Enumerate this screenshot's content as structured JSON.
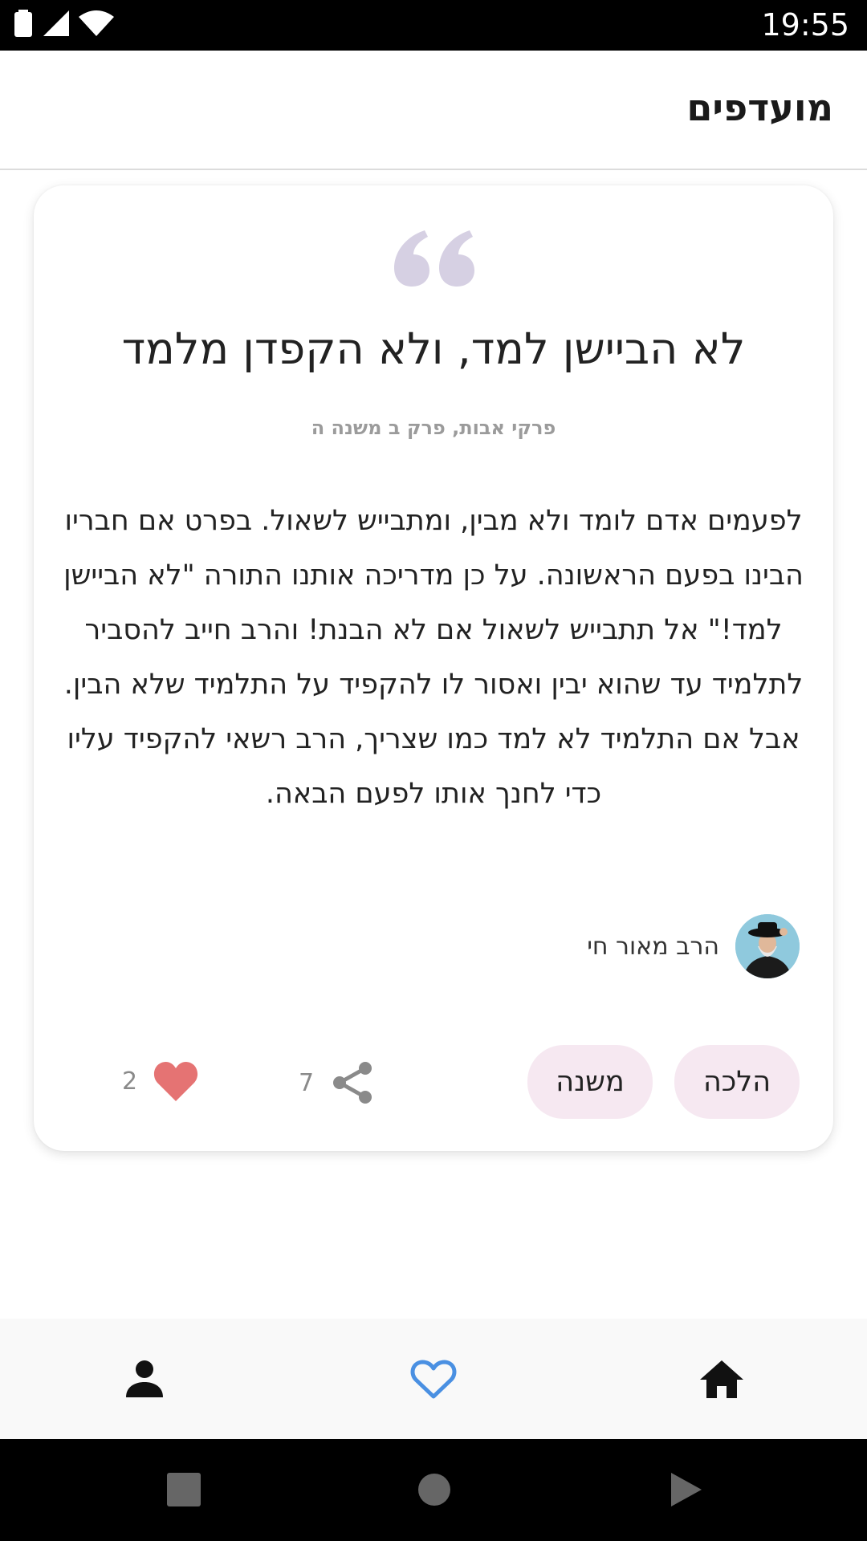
{
  "status_bar": {
    "time": "19:55",
    "icons": [
      "battery-icon",
      "signal-icon",
      "wifi-icon"
    ]
  },
  "app_bar": {
    "title": "מועדפים"
  },
  "card": {
    "title": "לא הביישן למד, ולא הקפדן מלמד",
    "source": "פרקי אבות, פרק ב משנה ה",
    "body": "לפעמים אדם לומד ולא מבין, ומתבייש לשאול. בפרט אם חבריו הבינו בפעם הראשונה. על כן מדריכה אותנו התורה \"לא הביישן למד!\" אל תתבייש לשאול אם לא הבנת! והרב חייב להסביר לתלמיד עד שהוא יבין ואסור לו להקפיד על התלמיד שלא הבין. אבל אם התלמיד לא למד כמו שצריך, הרב רשאי להקפיד עליו כדי לחנך אותו לפעם הבאה.",
    "author": "הרב מאור חי",
    "tags": [
      "הלכה",
      "משנה"
    ],
    "share_count": "7",
    "like_count": "2"
  },
  "bottom_nav": {
    "items": [
      "profile-icon",
      "favorites-heart-icon",
      "home-icon"
    ],
    "active": "favorites-heart-icon"
  },
  "colors": {
    "accent": "#4a90e2",
    "heart": "#e57373",
    "tag_bg": "#f6e8f1",
    "quote_icon": "#d6d0e3"
  }
}
